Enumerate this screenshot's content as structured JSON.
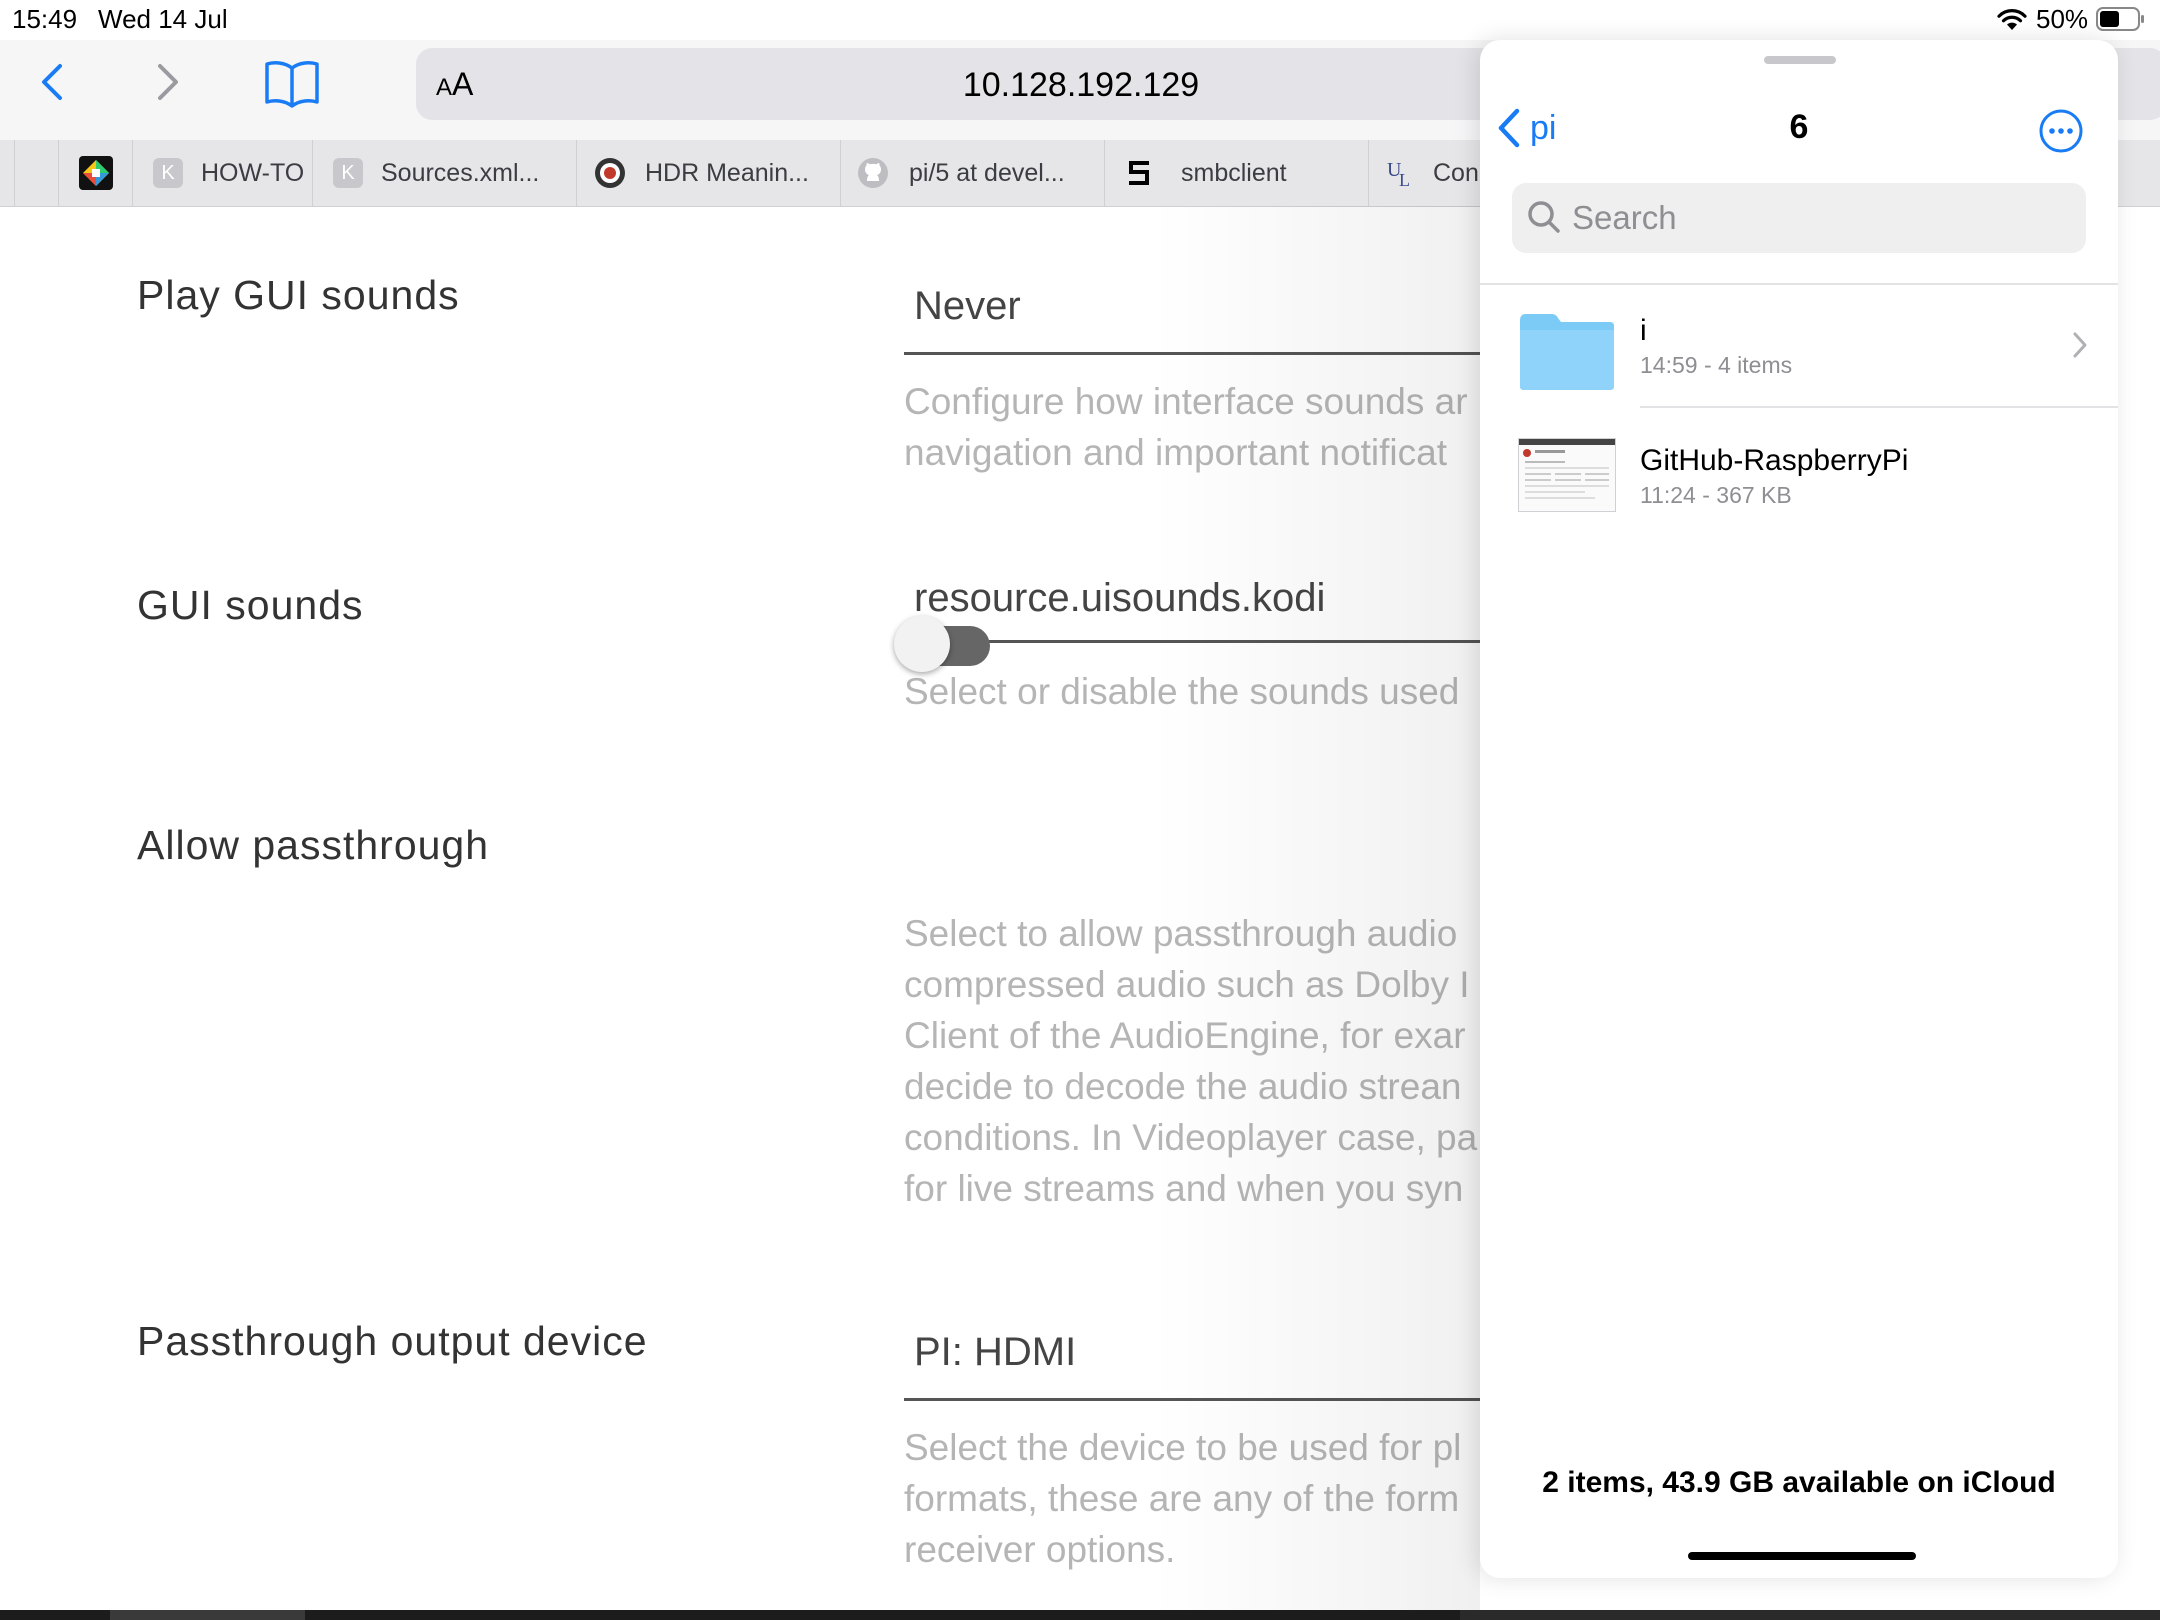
{
  "status_bar": {
    "time": "15:49",
    "date": "Wed 14 Jul",
    "battery": "50%"
  },
  "toolbar": {
    "reader_small": "A",
    "reader_large": "A",
    "url": "10.128.192.129"
  },
  "tabs": [
    {
      "label": "HOW-TO",
      "favicon": "K"
    },
    {
      "label": "Sources.xml...",
      "favicon": "K"
    },
    {
      "label": "HDR Meanin...",
      "favicon": ""
    },
    {
      "label": "pi/5 at devel...",
      "favicon": ""
    },
    {
      "label": "smbclient",
      "favicon": ""
    },
    {
      "label": "Con",
      "favicon": ""
    }
  ],
  "settings": [
    {
      "label": "Play GUI sounds",
      "value": "Never",
      "description": [
        "Configure how interface sounds ar",
        "navigation and important notificat"
      ]
    },
    {
      "label": "GUI sounds",
      "value": "resource.uisounds.kodi",
      "description": [
        "Select or disable the sounds used"
      ]
    },
    {
      "label": "Allow passthrough",
      "toggle": false,
      "description": [
        "Select to allow passthrough audio",
        "compressed audio such as Dolby I",
        "Client of the AudioEngine, for exar",
        "decide to decode the audio strean",
        "conditions. In Videoplayer case, pa",
        "for live streams and when you syn"
      ]
    },
    {
      "label": "Passthrough output device",
      "value": "PI: HDMI",
      "description": [
        "Select the device to be used for pl",
        "formats, these are any of the form",
        "receiver options."
      ]
    }
  ],
  "files": {
    "back_label": "pi",
    "title": "6",
    "search_placeholder": "Search",
    "items": [
      {
        "name": "i",
        "meta": "14:59 - 4 items",
        "kind": "folder"
      },
      {
        "name": "GitHub-RaspberryPi",
        "meta": "11:24 - 367 KB",
        "kind": "document"
      }
    ],
    "footer": "2 items, 43.9 GB available on iCloud"
  },
  "colors": {
    "accent": "#1a7cf5",
    "folder": "#7ccbf7",
    "toggle_off": "#666666"
  }
}
